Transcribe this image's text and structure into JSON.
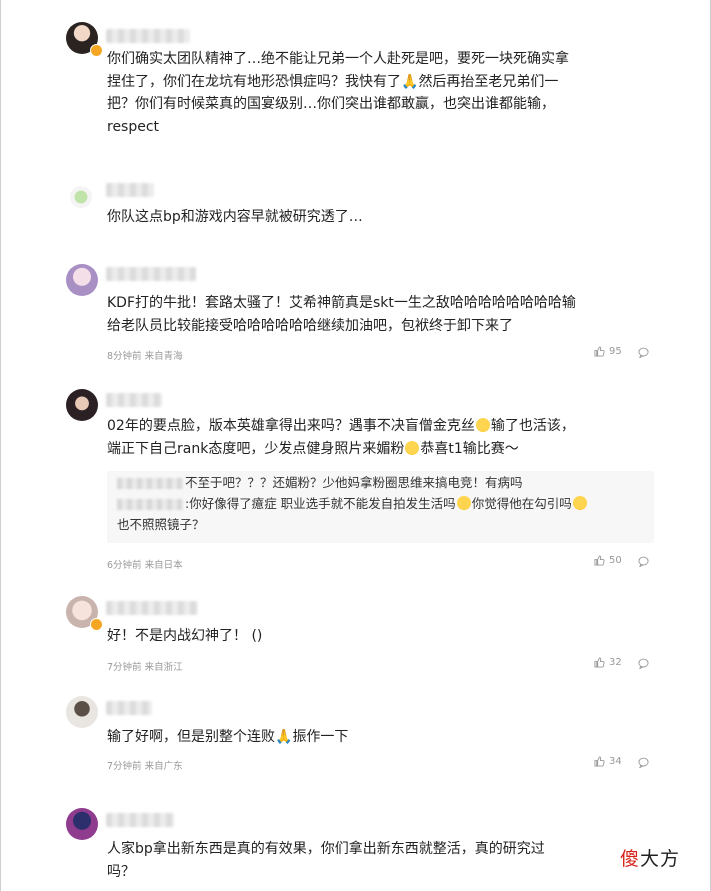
{
  "comments": [
    {
      "text": "你们确实太团队精神了…绝不能让兄弟一个人赴死是吧，要死一块死确实拿捏住了，你们在龙坑有地形恐惧症吗？我快有了🙏然后再抬至老兄弟们一把？你们有时候菜真的国宴级别…你们突出谁都敢赢，也突出谁都能输，respect",
      "line1": "你们确实太团队精神了…绝不能让兄弟一个人赴死是吧，要死一块死确实拿",
      "line2": "捏住了，你们在龙坑有地形恐惧症吗？我快有了",
      "line2b": "然后再抬至老兄弟们一",
      "line3": "把？你们有时候菜真的国宴级别…你们突出谁都敢赢，也突出谁都能输，",
      "line4": "respect"
    },
    {
      "text": "你队这点bp和游戏内容早就被研究透了…"
    },
    {
      "text": "KDF打的牛批！套路太骚了！艾希神箭真是skt一生之敌哈哈哈哈哈哈哈哈输给老队员比较能接受哈哈哈哈哈哈继续加油吧，包袱终于卸下来了",
      "line1": "KDF打的牛批！套路太骚了！艾希神箭真是skt一生之敌哈哈哈哈哈哈哈哈输",
      "line2": "给老队员比较能接受哈哈哈哈哈哈继续加油吧，包袱终于卸下来了",
      "meta": "8分钟前 来自青海",
      "likes": "95"
    },
    {
      "line1a": "02年的要点脸，版本英雄拿得出来吗？遇事不决盲僧金克丝",
      "line1b": "输了也活该，",
      "line2a": "端正下自己rank态度吧，少发点健身照片来媚粉",
      "line2b": "恭喜t1输比赛～",
      "replies": {
        "r1": "不至于吧？？？还媚粉？少他妈拿粉圈思维来搞电竞！有病吗",
        "r2a": ":你好像得了癔症 职业选手就不能发自拍发生活吗",
        "r2b": "你觉得他在勾引吗",
        "r3": "也不照照镜子？"
      },
      "meta": "6分钟前 来自日本",
      "likes": "50"
    },
    {
      "text": "好！不是内战幻神了！ ()",
      "meta": "7分钟前 来自浙江",
      "likes": "32"
    },
    {
      "text_a": "输了好啊，但是别整个连败",
      "text_b": "振作一下",
      "meta": "7分钟前 来自广东",
      "likes": "34"
    },
    {
      "line1": "人家bp拿出新东西是真的有效果，你们拿出新东西就整活，真的研究过",
      "line2": "吗？"
    }
  ],
  "icons": {
    "like": "thumbs-up-icon",
    "reply": "comment-bubble-icon",
    "pray": "praying-hands-emoji",
    "laugh": "laughing-emoji"
  },
  "watermark": {
    "red": "傻",
    "black": "大方"
  },
  "colors": {
    "meta": "#999999",
    "reply_bg": "#f7f7f7",
    "badge": "#f5a623",
    "watermark_red": "#d8231a"
  }
}
